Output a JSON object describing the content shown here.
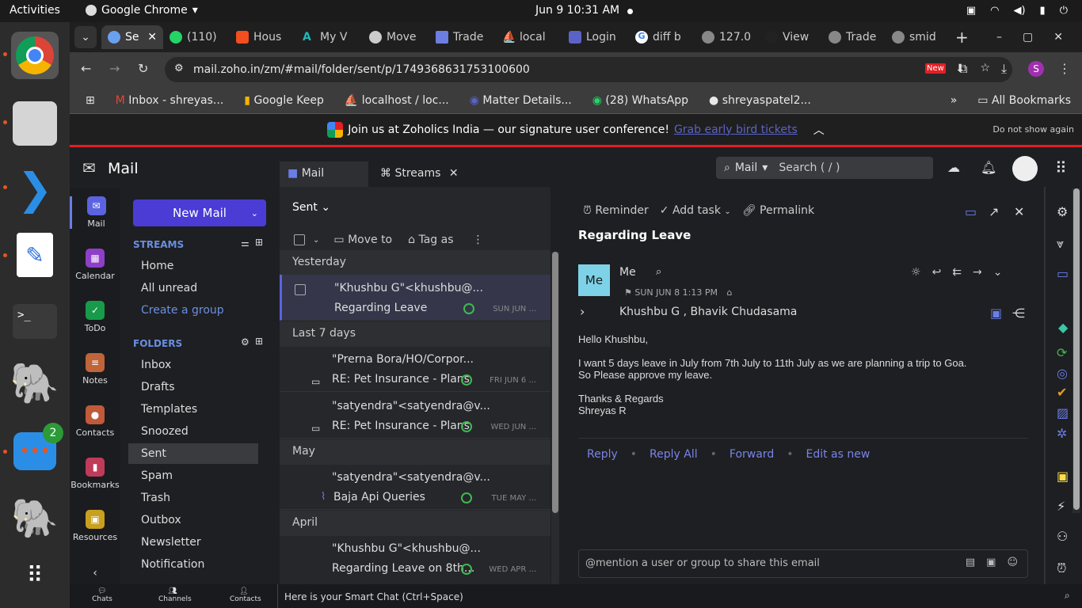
{
  "system": {
    "activities": "Activities",
    "app": "Google Chrome",
    "clock": "Jun 9  10:31 AM"
  },
  "dock": {
    "chat_badge": "2"
  },
  "browser": {
    "tabs": [
      "Se",
      "(110)",
      "Hous",
      "My V",
      "Move",
      "Trade",
      "local",
      "Login",
      "diff b",
      "127.0",
      "View",
      "Trade",
      "smid"
    ],
    "url": "mail.zoho.in/zm/#mail/folder/sent/p/1749368631753100600",
    "bookmarks": [
      "Inbox - shreyas...",
      "Google Keep",
      "localhost / loc...",
      "Matter Details...",
      "(28) WhatsApp",
      "shreyaspatel2..."
    ],
    "all_bookmarks": "All Bookmarks",
    "new_badge": "New",
    "profile_initial": "S"
  },
  "banner": {
    "text": "Join us at Zoholics India — our signature user conference!",
    "link": "Grab early bird tickets",
    "dismiss": "Do not show again"
  },
  "zoho": {
    "app_title": "Mail",
    "tabs": [
      "Mail",
      "Streams"
    ],
    "search_scope": "Mail",
    "search_placeholder": "Search ( / )",
    "nav": [
      "Mail",
      "Calendar",
      "ToDo",
      "Notes",
      "Contacts",
      "Bookmarks",
      "Resources"
    ],
    "new_mail": "New Mail",
    "streams_label": "STREAMS",
    "streams": [
      "Home",
      "All unread",
      "Create a group"
    ],
    "folders_label": "FOLDERS",
    "folders": [
      "Inbox",
      "Drafts",
      "Templates",
      "Snoozed",
      "Sent",
      "Spam",
      "Trash",
      "Outbox",
      "Newsletter",
      "Notification"
    ],
    "list": {
      "folder": "Sent",
      "move_to": "Move to",
      "tag_as": "Tag as",
      "groups": [
        "Yesterday",
        "Last 7 days",
        "May",
        "April"
      ],
      "items": [
        {
          "from": "\"Khushbu G\"<khushbu@...",
          "subject": "Regarding Leave",
          "date": "SUN JUN ..."
        },
        {
          "from": "\"Prerna Bora/HO/Corpor...",
          "subject": "RE: Pet Insurance - Plans",
          "date": "FRI JUN 6 ..."
        },
        {
          "from": "\"satyendra\"<satyendra@v...",
          "subject": "RE: Pet Insurance - Plans",
          "date": "WED JUN ..."
        },
        {
          "from": "\"satyendra\"<satyendra@v...",
          "subject": "Baja Api Queries",
          "date": "TUE MAY ..."
        },
        {
          "from": "\"Khushbu G\"<khushbu@...",
          "subject": "Regarding Leave on 8th...",
          "date": "WED APR ..."
        }
      ]
    },
    "reader": {
      "reminder": "Reminder",
      "add_task": "Add task",
      "permalink": "Permalink",
      "subject": "Regarding Leave",
      "avatar": "Me",
      "sender": "Me",
      "sent_time": "SUN JUN 8 1:13 PM",
      "recipients": "Khushbu G , Bhavik Chudasama",
      "body": [
        "Hello Khushbu,",
        "I want 5 days leave in July from 7th July to 11th July as we are planning a trip to Goa.",
        "So Please approve my leave.",
        "Thanks & Regards",
        "Shreyas R"
      ],
      "actions": [
        "Reply",
        "Reply All",
        "Forward",
        "Edit as new"
      ],
      "comment_placeholder": "@mention a user or group to share this email"
    },
    "bottom": {
      "items": [
        "Chats",
        "Channels",
        "Contacts"
      ],
      "smartchat": "Here is your Smart Chat (Ctrl+Space)"
    }
  }
}
